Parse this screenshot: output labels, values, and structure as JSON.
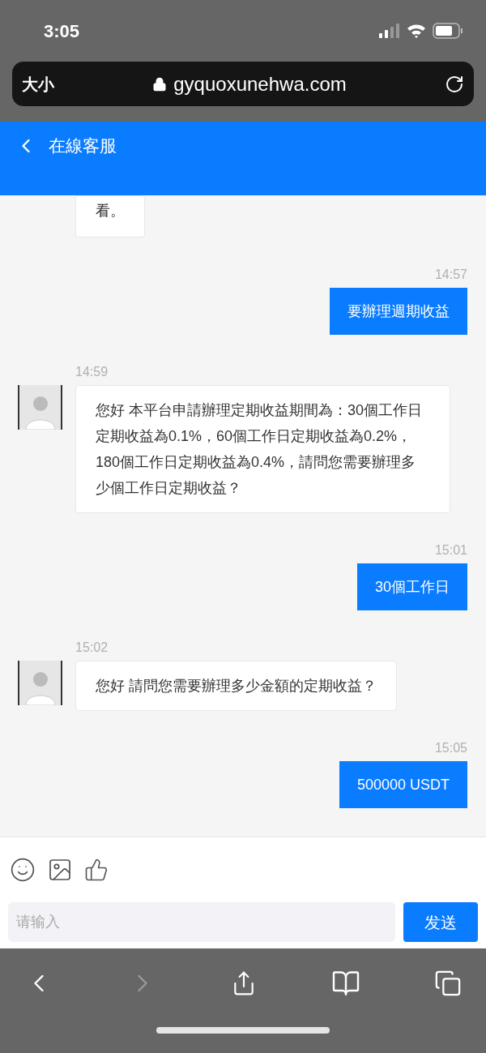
{
  "status_bar": {
    "time": "3:05"
  },
  "browser": {
    "text_size": "大小",
    "url": "gyquoxunehwa.com"
  },
  "header": {
    "title": "在線客服"
  },
  "messages": [
    {
      "kind": "received",
      "text": "看。"
    },
    {
      "kind": "sent",
      "time": "14:57",
      "text": "要辦理週期收益"
    },
    {
      "kind": "received",
      "time": "14:59",
      "text": "您好 本平台申請辦理定期收益期間為：30個工作日定期收益為0.1%，60個工作日定期收益為0.2%，180個工作日定期收益為0.4%，請問您需要辦理多少個工作日定期收益？"
    },
    {
      "kind": "sent",
      "time": "15:01",
      "text": "30個工作日"
    },
    {
      "kind": "received",
      "time": "15:02",
      "text": "您好 請問您需要辦理多少金額的定期收益？"
    },
    {
      "kind": "sent",
      "time": "15:05",
      "text": "500000 USDT"
    }
  ],
  "composer": {
    "placeholder": "请输入",
    "send": "发送"
  }
}
